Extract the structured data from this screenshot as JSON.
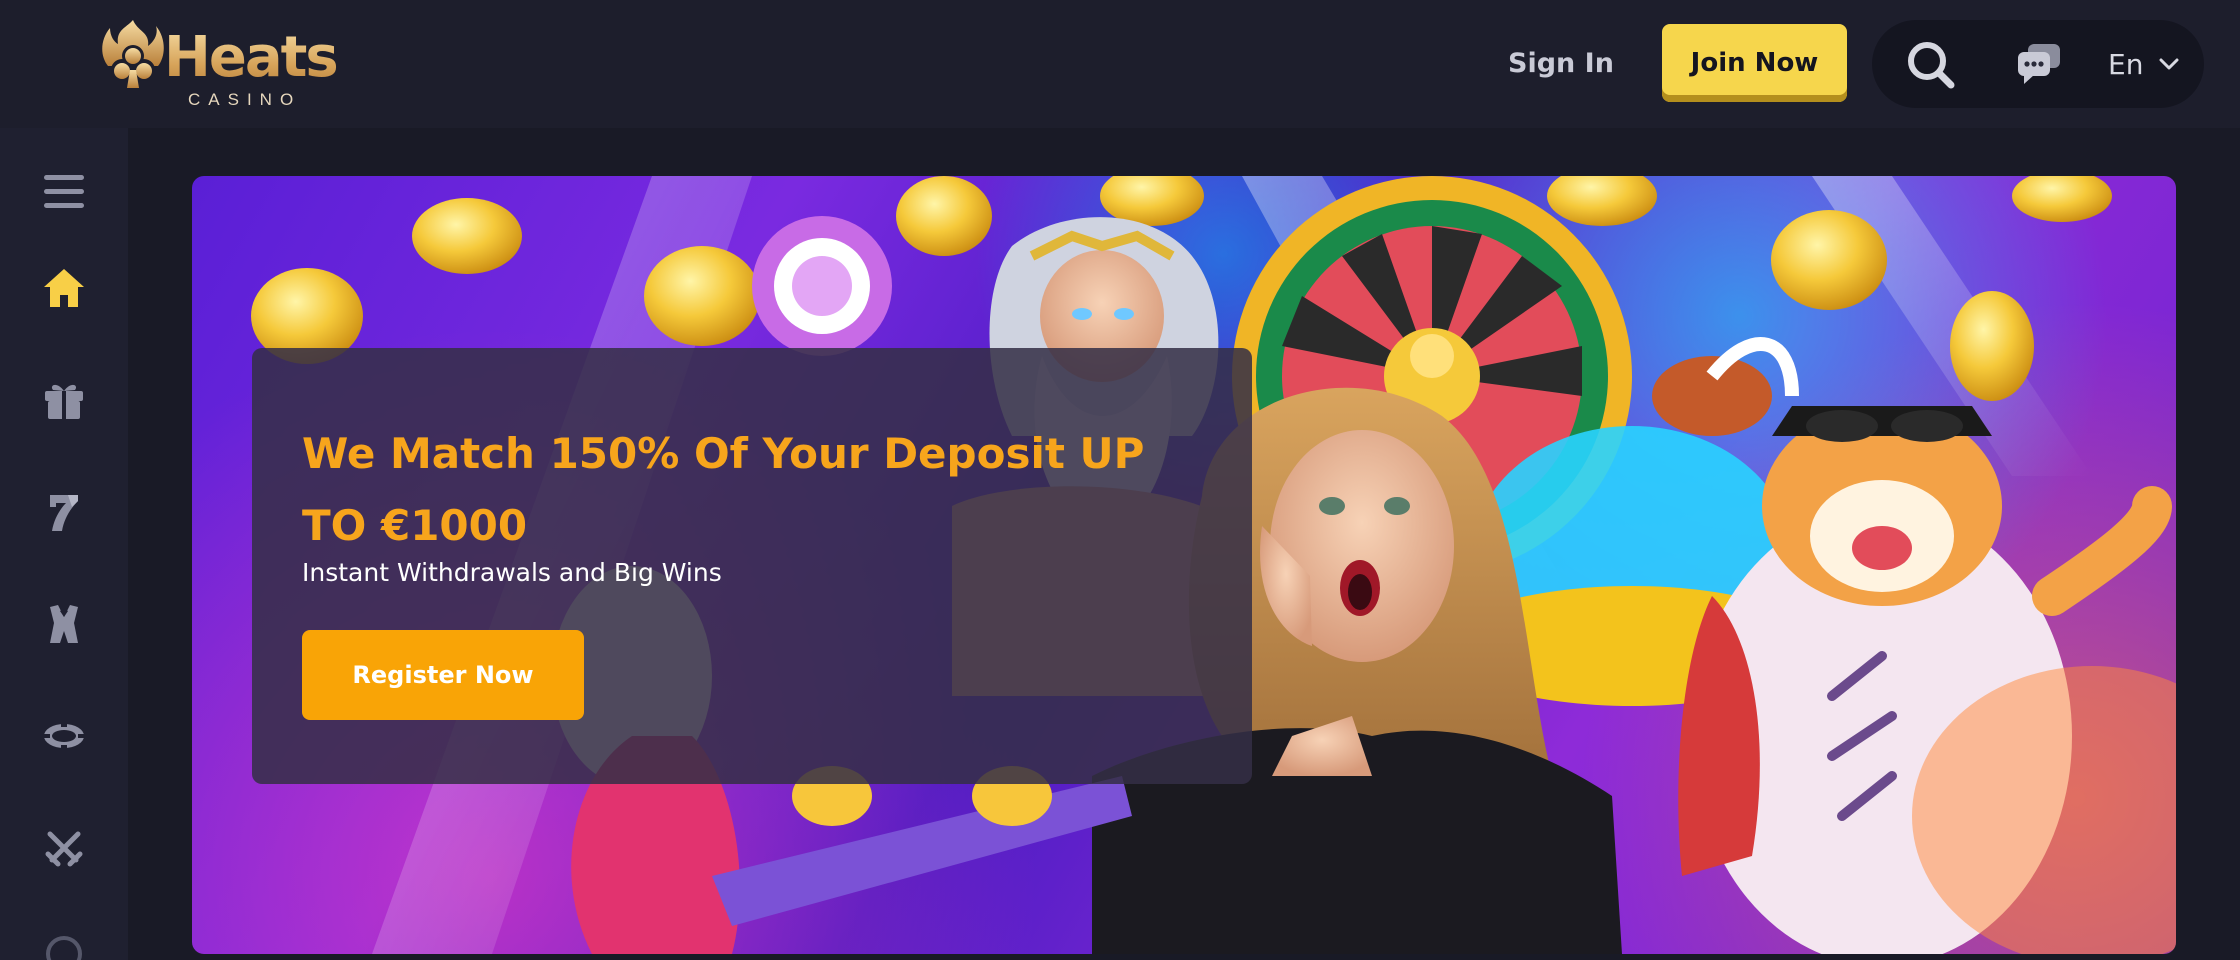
{
  "brand": {
    "name": "Heats",
    "subtitle": "CASINO"
  },
  "header": {
    "sign_in_label": "Sign In",
    "join_label": "Join Now",
    "language": "En",
    "icons": [
      "search-icon",
      "chat-icon",
      "chevron-down-icon"
    ]
  },
  "sidebar": {
    "items": [
      {
        "name": "menu",
        "icon": "menu-icon",
        "active": false
      },
      {
        "name": "home",
        "icon": "home-icon",
        "active": true
      },
      {
        "name": "promotions",
        "icon": "gift-icon",
        "active": false
      },
      {
        "name": "slots",
        "icon": "seven-icon",
        "active": false
      },
      {
        "name": "live-casino",
        "icon": "dealer-icon",
        "active": false
      },
      {
        "name": "table-games",
        "icon": "chip-icon",
        "active": false
      },
      {
        "name": "sports",
        "icon": "crossed-swords-icon",
        "active": false
      }
    ]
  },
  "hero": {
    "title": "We Match 150% Of Your Deposit UP TO €1000",
    "subtitle": "Instant Withdrawals and Big Wins",
    "cta_label": "Register Now"
  },
  "colors": {
    "background": "#1b1c2a",
    "accent_yellow": "#f6d64c",
    "accent_orange": "#f9a406",
    "promo_title": "#f7a51c",
    "active_icon": "#f8cf47",
    "inactive_icon": "#8e90a3"
  }
}
